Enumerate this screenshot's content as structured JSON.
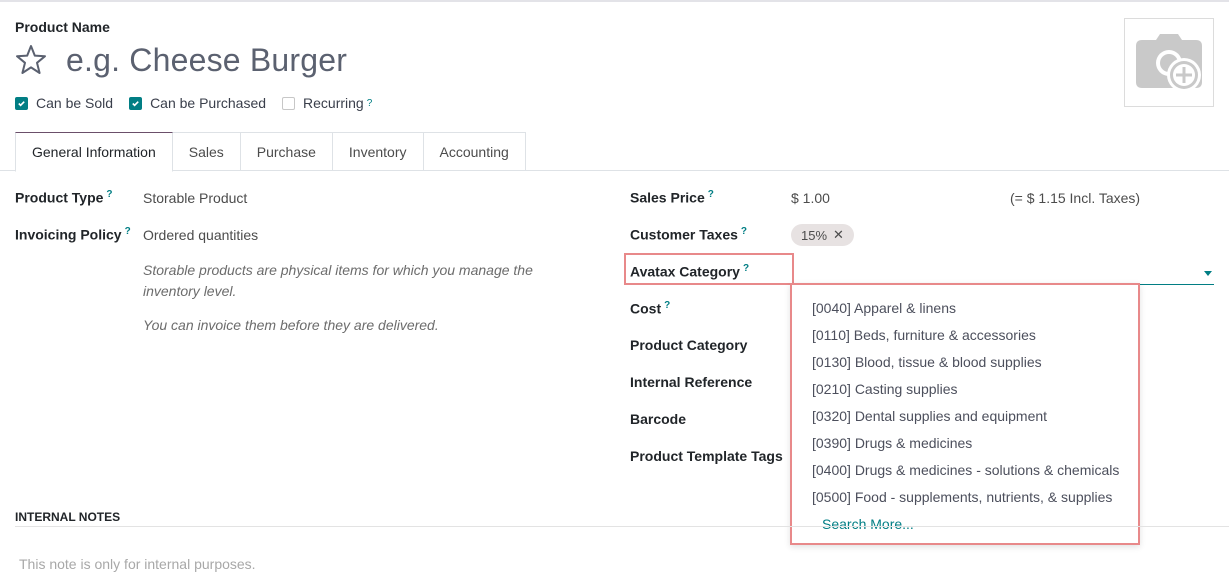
{
  "header": {
    "product_name_label": "Product Name",
    "product_name_placeholder": "e.g. Cheese Burger",
    "favorite_icon": "star-outline-icon",
    "image_icon": "camera-plus-icon"
  },
  "options": [
    {
      "label": "Can be Sold",
      "checked": true,
      "help": ""
    },
    {
      "label": "Can be Purchased",
      "checked": true,
      "help": ""
    },
    {
      "label": "Recurring",
      "checked": false,
      "help": "?"
    }
  ],
  "tabs": [
    {
      "label": "General Information",
      "active": true
    },
    {
      "label": "Sales",
      "active": false
    },
    {
      "label": "Purchase",
      "active": false
    },
    {
      "label": "Inventory",
      "active": false
    },
    {
      "label": "Accounting",
      "active": false
    }
  ],
  "left_fields": {
    "product_type": {
      "label": "Product Type",
      "help": "?",
      "value": "Storable Product"
    },
    "invoicing_policy": {
      "label": "Invoicing Policy",
      "help": "?",
      "value": "Ordered quantities"
    },
    "desc1": "Storable products are physical items for which you manage the inventory level.",
    "desc2": "You can invoice them before they are delivered."
  },
  "right_fields": {
    "sales_price": {
      "label": "Sales Price",
      "help": "?",
      "value": "$ 1.00",
      "incl_taxes": "(= $ 1.15 Incl. Taxes)"
    },
    "customer_taxes": {
      "label": "Customer Taxes",
      "help": "?",
      "tag": "15%",
      "remove": "✕"
    },
    "avatax_category": {
      "label": "Avatax Category",
      "help": "?",
      "value": ""
    },
    "cost": {
      "label": "Cost",
      "help": "?"
    },
    "product_category": {
      "label": "Product Category"
    },
    "internal_reference": {
      "label": "Internal Reference"
    },
    "barcode": {
      "label": "Barcode"
    },
    "product_template_tags": {
      "label": "Product Template Tags"
    }
  },
  "dropdown": {
    "items": [
      "[0040] Apparel & linens",
      "[0110] Beds, furniture & accessories",
      "[0130] Blood, tissue & blood supplies",
      "[0210] Casting supplies",
      "[0320] Dental supplies and equipment",
      "[0390] Drugs & medicines",
      "[0400] Drugs & medicines - solutions & chemicals",
      "[0500] Food - supplements, nutrients, & supplies"
    ],
    "search_more": "Search More..."
  },
  "notes": {
    "heading": "INTERNAL NOTES",
    "placeholder": "This note is only for internal purposes."
  },
  "colors": {
    "accent": "#017e84",
    "highlight": "#e8898a",
    "tab_active_top": "#6b4f6a"
  }
}
